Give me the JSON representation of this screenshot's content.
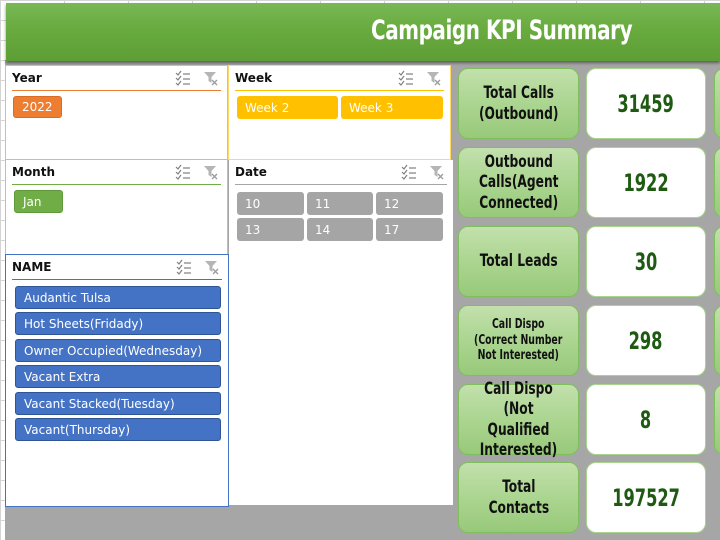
{
  "header": {
    "title": "Campaign KPI Summary"
  },
  "slicers": {
    "year": {
      "title": "Year",
      "items": [
        "2022"
      ]
    },
    "week": {
      "title": "Week",
      "items": [
        "Week 2",
        "Week 3"
      ]
    },
    "month": {
      "title": "Month",
      "items": [
        "Jan"
      ]
    },
    "date": {
      "title": "Date",
      "items": [
        "10",
        "11",
        "12",
        "13",
        "14",
        "17"
      ]
    },
    "name": {
      "title": "NAME",
      "items": [
        "Audantic Tulsa",
        "Hot Sheets(Fridady)",
        "Owner Occupied(Wednesday)",
        "Vacant Extra",
        "Vacant Stacked(Tuesday)",
        "Vacant(Thursday)"
      ]
    }
  },
  "icons": {
    "multi_select": "multi-select-icon",
    "clear_filter": "clear-filter-icon"
  },
  "colors": {
    "header": "#68ab3e",
    "year": "#ed7d31",
    "week": "#ffc000",
    "month": "#70ad47",
    "date": "#a5a5a5",
    "name": "#4472c4",
    "kpi_value": "#1e5a12"
  },
  "kpis": [
    {
      "label_lines": [
        "Total Calls",
        "(Outbound)"
      ],
      "value": "31459"
    },
    {
      "label_lines": [
        "Outbound",
        "Calls(Agent",
        "Connected)"
      ],
      "value": "1922"
    },
    {
      "label_lines": [
        "Total Leads"
      ],
      "value": "30"
    },
    {
      "label_lines": [
        "Call Dispo",
        "(Correct Number",
        "Not Interested)"
      ],
      "value": "298"
    },
    {
      "label_lines": [
        "Call Dispo",
        "(Not Qualified",
        "Interested)"
      ],
      "value": "8"
    },
    {
      "label_lines": [
        "Total",
        "Contacts"
      ],
      "value": "197527"
    }
  ]
}
